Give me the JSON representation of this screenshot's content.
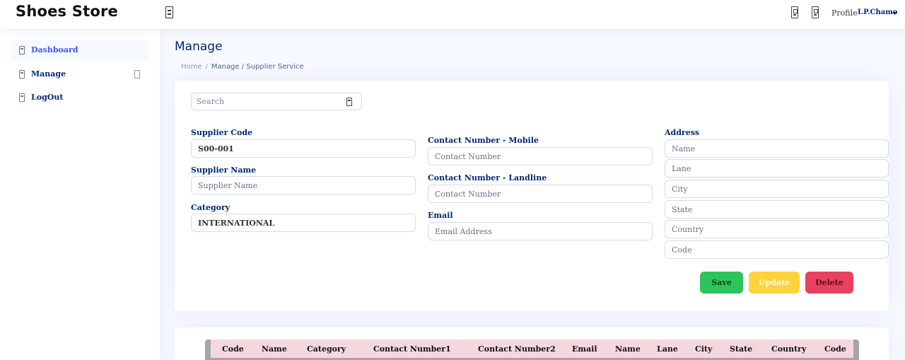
{
  "header": {
    "brand": "Shoes Store",
    "toggle_icon": "menu-toggle-icon",
    "icons": [
      "notification-icon",
      "message-icon"
    ],
    "profile_label": "Profile",
    "profile_name": "I.P.Chamo"
  },
  "sidebar": {
    "items": [
      {
        "label": "Dashboard",
        "icon": "grid-icon",
        "active": true
      },
      {
        "label": "Manage",
        "icon": "manage-icon",
        "active": false
      },
      {
        "label": "LogOut",
        "icon": "logout-icon",
        "active": false
      }
    ]
  },
  "page": {
    "title": "Manage",
    "breadcrumb": {
      "home": "Home",
      "current": "Manage / Supplier Service"
    }
  },
  "form": {
    "search_placeholder": "Search",
    "supplier_code": {
      "label": "Supplier Code",
      "value": "S00-001"
    },
    "supplier_name": {
      "label": "Supplier Name",
      "placeholder": "Supplier Name"
    },
    "category": {
      "label": "Category",
      "value": "INTERNATIONAL"
    },
    "contact_mobile": {
      "label": "Contact Number - Mobile",
      "placeholder": "Contact Number"
    },
    "contact_landline": {
      "label": "Contact Number - Landline",
      "placeholder": "Contact Number"
    },
    "email": {
      "label": "Email",
      "placeholder": "Email Address"
    },
    "address": {
      "label": "Address",
      "name_placeholder": "Name",
      "lane_placeholder": "Lane",
      "city_placeholder": "City",
      "state_placeholder": "State",
      "country_placeholder": "Country",
      "code_placeholder": "Code"
    },
    "buttons": {
      "save": "Save",
      "update": "Update",
      "delete": "Delete"
    }
  },
  "table": {
    "columns": [
      "Code",
      "Name",
      "Category",
      "Contact Number1",
      "Contact Number2",
      "Email",
      "Name",
      "Lane",
      "City",
      "State",
      "Country",
      "Code"
    ]
  },
  "colors": {
    "save": "#2ec45c",
    "update": "#ffd43b",
    "delete": "#e8415f",
    "table_header": "#f4d8dd",
    "accent": "#4154f1",
    "navy": "#012970"
  }
}
